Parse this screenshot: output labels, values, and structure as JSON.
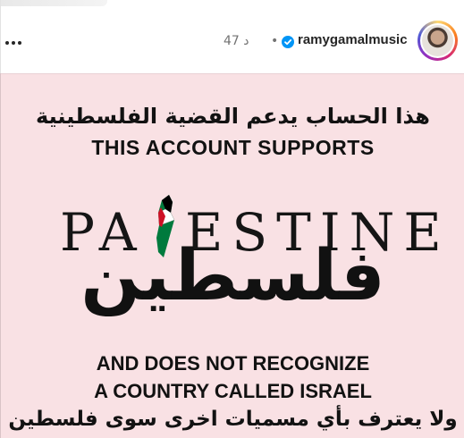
{
  "header": {
    "username": "ramygamalmusic",
    "time_ago": "47 د",
    "separator": "•",
    "verified_icon": "verified-badge-icon",
    "more_icon": "more-options-icon"
  },
  "post": {
    "arabic_top": "هذا الحساب يدعم القضية الفلسطينية",
    "english_line_1": "THIS ACCOUNT SUPPORTS",
    "palestine_left": "PA",
    "palestine_right": "ESTINE",
    "arabic_big": "فلسطين",
    "english_line_2": "AND DOES NOT RECOGNIZE",
    "english_line_3": "A COUNTRY CALLED ISRAEL",
    "arabic_bottom": "ولا يعترف بأي مسميات اخرى سوى فلسطين"
  },
  "colors": {
    "image_background": "#f9e1e4",
    "verified_blue": "#0095f6",
    "flag_red": "#ce1126",
    "flag_green": "#007a3d",
    "flag_black": "#000000"
  }
}
